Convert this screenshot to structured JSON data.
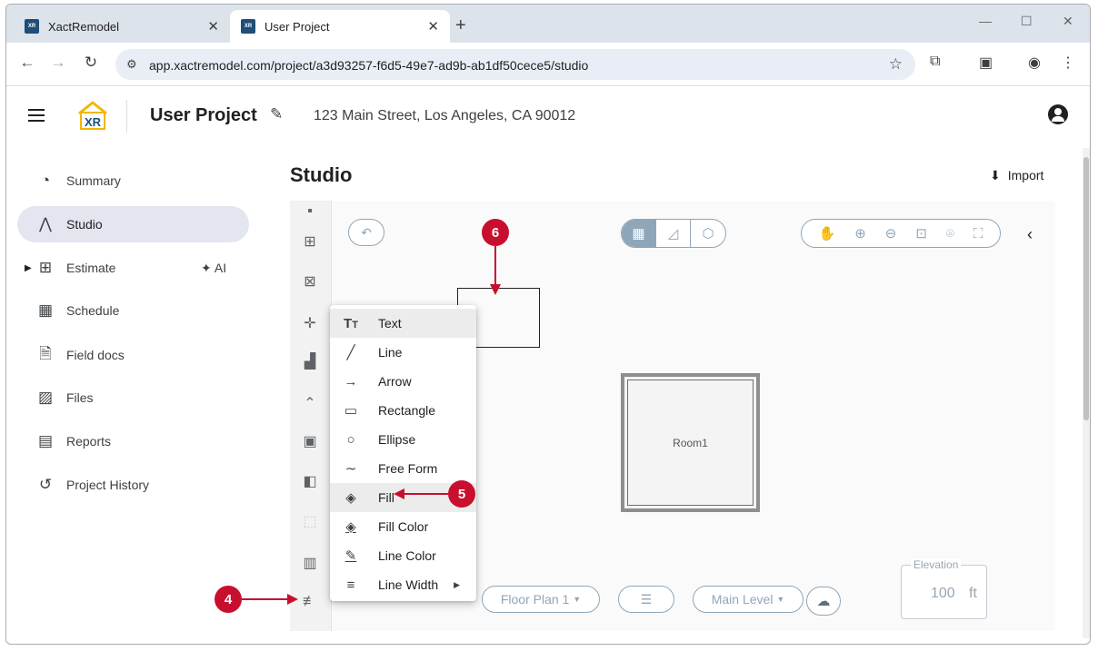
{
  "browser": {
    "tabs": [
      {
        "label": "XactRemodel",
        "favicon": "XR"
      },
      {
        "label": "User Project",
        "favicon": "XR"
      }
    ],
    "url": "app.xactremodel.com/project/a3d93257-f6d5-49e7-ad9b-ab1df50cece5/studio"
  },
  "header": {
    "logo": "XR",
    "project_title": "User Project",
    "address": "123 Main Street, Los Angeles, CA 90012"
  },
  "sidebar": {
    "items": [
      {
        "label": "Summary",
        "icon": "gauge-icon"
      },
      {
        "label": "Studio",
        "icon": "compass-icon"
      },
      {
        "label": "Estimate",
        "icon": "calculator-icon",
        "extra": "AI"
      },
      {
        "label": "Schedule",
        "icon": "calendar-icon"
      },
      {
        "label": "Field docs",
        "icon": "document-add-icon"
      },
      {
        "label": "Files",
        "icon": "images-icon"
      },
      {
        "label": "Reports",
        "icon": "report-icon"
      },
      {
        "label": "Project History",
        "icon": "history-icon"
      }
    ]
  },
  "main": {
    "title": "Studio",
    "import_label": "Import",
    "room_label": "Room1",
    "floor_plan_label": "Floor Plan 1",
    "level_label": "Main Level",
    "elevation": {
      "label": "Elevation",
      "value": "100",
      "unit": "ft"
    }
  },
  "menu": {
    "items": [
      {
        "label": "Text",
        "icon": "text-icon"
      },
      {
        "label": "Line",
        "icon": "line-icon"
      },
      {
        "label": "Arrow",
        "icon": "arrow-icon"
      },
      {
        "label": "Rectangle",
        "icon": "rectangle-icon"
      },
      {
        "label": "Ellipse",
        "icon": "ellipse-icon"
      },
      {
        "label": "Free Form",
        "icon": "freeform-icon"
      },
      {
        "label": "Fill",
        "icon": "fill-bucket-icon",
        "highlighted": true
      },
      {
        "label": "Fill Color",
        "icon": "fill-color-icon"
      },
      {
        "label": "Line Color",
        "icon": "line-color-icon"
      },
      {
        "label": "Line Width",
        "icon": "line-width-icon",
        "submenu": true
      }
    ]
  },
  "callouts": {
    "four": "4",
    "five": "5",
    "six": "6"
  },
  "colors": {
    "accent": "#8fa6b9",
    "callout": "#c8102e",
    "active_nav": "#e3e6ef"
  }
}
